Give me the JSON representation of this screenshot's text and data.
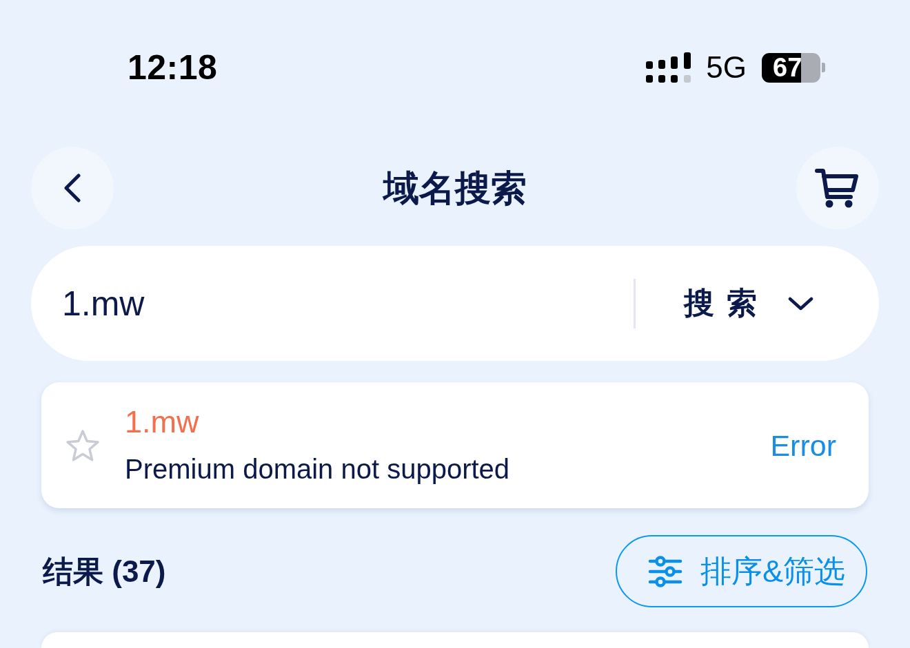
{
  "status_bar": {
    "time": "12:18",
    "network": "5G",
    "battery": "67"
  },
  "header": {
    "title": "域名搜索"
  },
  "search": {
    "value": "1.mw",
    "mode": "搜索"
  },
  "result_card": {
    "starred": false,
    "domain": "1.mw",
    "message": "Premium domain not supported",
    "status": "Error"
  },
  "results": {
    "label": "结果 (37)",
    "sort_filter_button": "排序&筛选"
  }
}
